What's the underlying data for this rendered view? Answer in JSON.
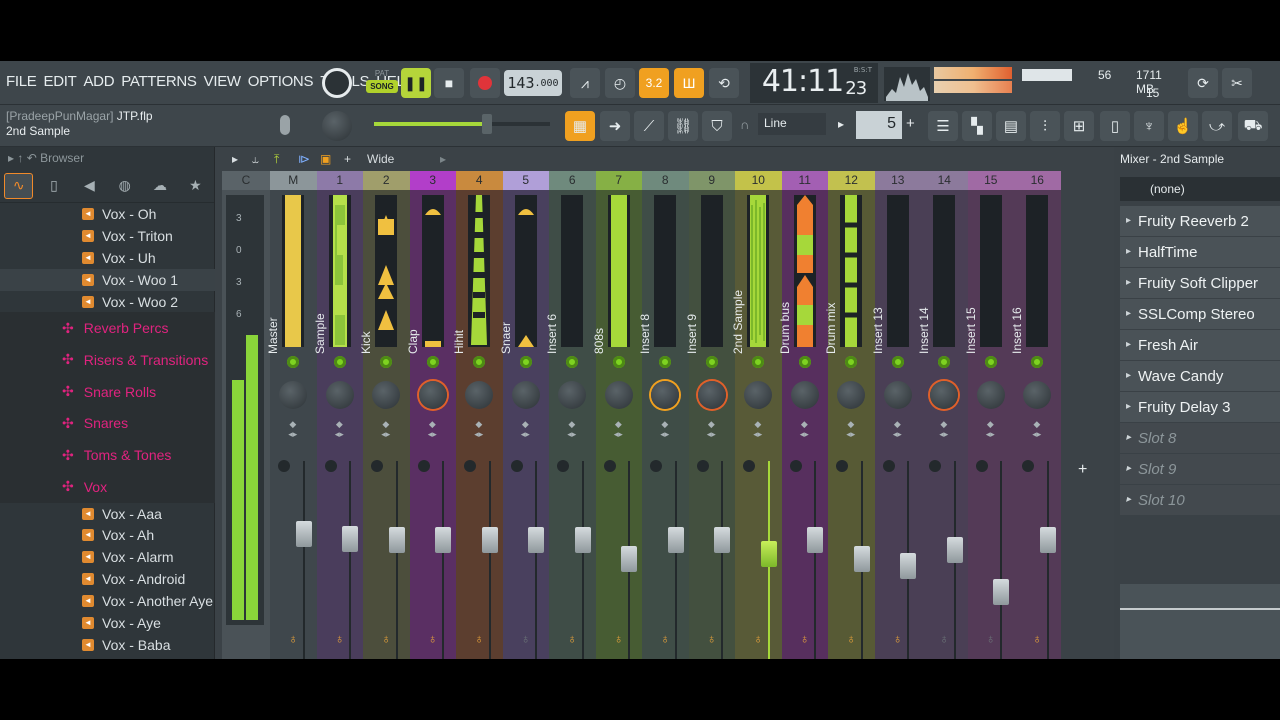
{
  "menu": [
    "FILE",
    "EDIT",
    "ADD",
    "PATTERNS",
    "VIEW",
    "OPTIONS",
    "TOOLS",
    "HELP"
  ],
  "transport": {
    "pat": "PAT",
    "song": "SONG",
    "tempo": "143",
    "tempo_dec": ".000"
  },
  "time": {
    "main": "41:11",
    "sub": "23",
    "label": "B:S:T"
  },
  "perf": {
    "cpu": "56",
    "ram": "1711 MB",
    "poly": "15"
  },
  "hint": {
    "user": "[PradeepPunMagar]",
    "file": "JTP.flp",
    "sub": "2nd Sample"
  },
  "snap": {
    "mode": "Line",
    "step": "5"
  },
  "browser": {
    "title": "Browser",
    "items": [
      {
        "type": "file",
        "label": "Vox - Oh"
      },
      {
        "type": "file",
        "label": "Vox - Triton"
      },
      {
        "type": "file",
        "label": "Vox - Uh"
      },
      {
        "type": "file",
        "label": "Vox - Woo 1",
        "sel": true
      },
      {
        "type": "file",
        "label": "Vox - Woo 2"
      },
      {
        "type": "folder",
        "label": "Reverb Percs"
      },
      {
        "type": "folder",
        "label": "Risers & Transitions"
      },
      {
        "type": "folder",
        "label": "Snare Rolls"
      },
      {
        "type": "folder",
        "label": "Snares"
      },
      {
        "type": "folder",
        "label": "Toms & Tones"
      },
      {
        "type": "folder",
        "label": "Vox"
      },
      {
        "type": "file",
        "label": "Vox - Aaa"
      },
      {
        "type": "file",
        "label": "Vox - Ah"
      },
      {
        "type": "file",
        "label": "Vox - Alarm"
      },
      {
        "type": "file",
        "label": "Vox - Android"
      },
      {
        "type": "file",
        "label": "Vox - Another Aye"
      },
      {
        "type": "file",
        "label": "Vox - Aye"
      },
      {
        "type": "file",
        "label": "Vox - Baba"
      }
    ]
  },
  "mixer": {
    "toolbar_label": "Wide",
    "scale": [
      "3",
      "0",
      "3",
      "6"
    ],
    "strips": [
      {
        "num": "C",
        "name": "",
        "color": "#4a5257",
        "numcolor": "#5a6368",
        "wave": "none"
      },
      {
        "num": "M",
        "name": "Master",
        "color": "#3f474c",
        "numcolor": "#8c969a",
        "wave": "yellow"
      },
      {
        "num": "1",
        "name": "Sample",
        "color": "#4a3d5c",
        "numcolor": "#8d7aa8",
        "wave": "green"
      },
      {
        "num": "2",
        "name": "Kick",
        "color": "#4c4e3c",
        "numcolor": "#a09e6b",
        "wave": "kick"
      },
      {
        "num": "3",
        "name": "Clap",
        "color": "#5a2f63",
        "numcolor": "#b23ec9",
        "wave": "clap"
      },
      {
        "num": "4",
        "name": "Hihit",
        "color": "#5c3e2f",
        "numcolor": "#c98a3e",
        "wave": "hihat"
      },
      {
        "num": "5",
        "name": "Snaer",
        "color": "#49405e",
        "numcolor": "#b09fd8",
        "wave": "snare"
      },
      {
        "num": "6",
        "name": "Insert 6",
        "color": "#3f4d47",
        "numcolor": "#6f8a7d",
        "wave": "none"
      },
      {
        "num": "7",
        "name": "808s",
        "color": "#475c33",
        "numcolor": "#86b045",
        "wave": "808"
      },
      {
        "num": "8",
        "name": "Insert 8",
        "color": "#3f4d47",
        "numcolor": "#6f8a7d",
        "wave": "none"
      },
      {
        "num": "9",
        "name": "Insert 9",
        "color": "#43503f",
        "numcolor": "#7f9569",
        "wave": "none"
      },
      {
        "num": "10",
        "name": "2nd Sample",
        "color": "#585a37",
        "numcolor": "#c3c24a",
        "wave": "sample2"
      },
      {
        "num": "11",
        "name": "Drum bus",
        "color": "#572f5e",
        "numcolor": "#a35fb3",
        "wave": "drumbus"
      },
      {
        "num": "12",
        "name": "Drum mix",
        "color": "#575a35",
        "numcolor": "#c2c14f",
        "wave": "drummix"
      },
      {
        "num": "13",
        "name": "Insert 13",
        "color": "#4a3f55",
        "numcolor": "#8c7a9c",
        "wave": "none"
      },
      {
        "num": "14",
        "name": "Insert 14",
        "color": "#4a3f55",
        "numcolor": "#8c7a9c",
        "wave": "none"
      },
      {
        "num": "15",
        "name": "Insert 15",
        "color": "#543a57",
        "numcolor": "#a06aa4",
        "wave": "none"
      },
      {
        "num": "16",
        "name": "Insert 16",
        "color": "#543a57",
        "numcolor": "#a06aa4",
        "wave": "none"
      }
    ]
  },
  "panel": {
    "title": "Mixer - 2nd Sample",
    "input": "(none)",
    "slots": [
      {
        "label": "Fruity Reeverb 2",
        "empty": false
      },
      {
        "label": "HalfTime",
        "empty": false
      },
      {
        "label": "Fruity Soft Clipper",
        "empty": false
      },
      {
        "label": "SSLComp Stereo",
        "empty": false
      },
      {
        "label": "Fresh Air",
        "empty": false
      },
      {
        "label": "Wave Candy",
        "empty": false
      },
      {
        "label": "Fruity Delay 3",
        "empty": false
      },
      {
        "label": "Slot 8",
        "empty": true
      },
      {
        "label": "Slot 9",
        "empty": true
      },
      {
        "label": "Slot 10",
        "empty": true
      }
    ]
  }
}
